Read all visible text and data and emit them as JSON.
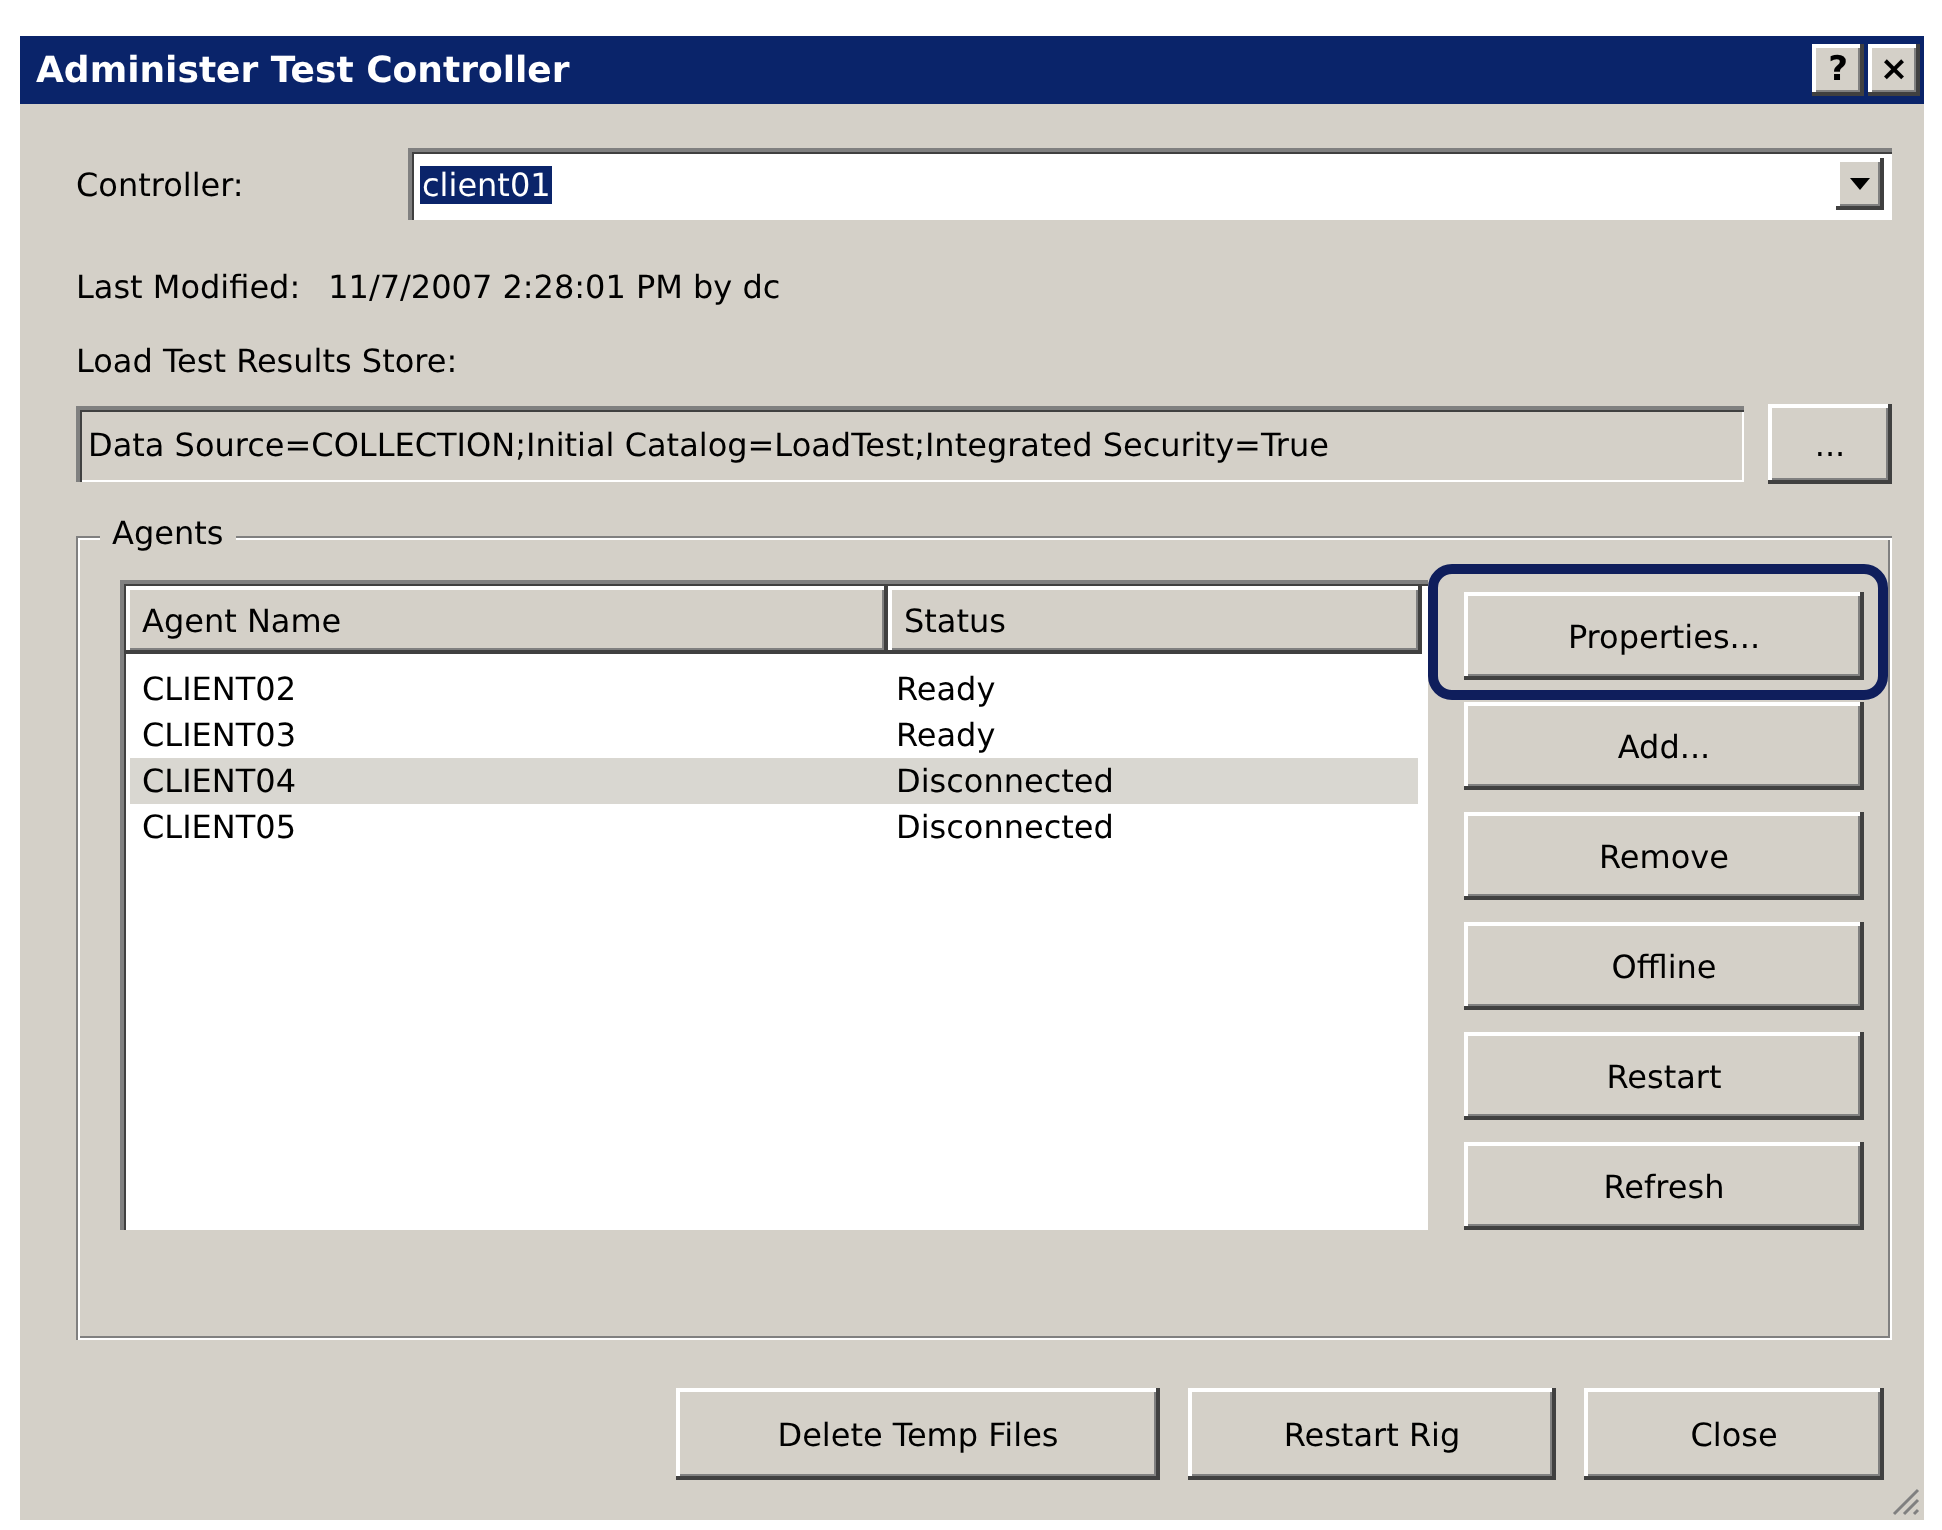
{
  "window": {
    "title": "Administer Test Controller",
    "title_buttons": [
      "?",
      "×"
    ]
  },
  "controller": {
    "label": "Controller:",
    "value": "client01",
    "value_selected": true
  },
  "last_modified": {
    "label": "Last Modified:",
    "value": "11/7/2007 2:28:01 PM by dc"
  },
  "results_store": {
    "label": "Load Test Results Store:",
    "value": "Data Source=COLLECTION;Initial Catalog=LoadTest;Integrated Security=True",
    "browse_button": "..."
  },
  "agents": {
    "title": "Agents",
    "columns": [
      "Agent Name",
      "Status"
    ],
    "rows": [
      {
        "name": "CLIENT02",
        "status": "Ready",
        "selected": false
      },
      {
        "name": "CLIENT03",
        "status": "Ready",
        "selected": false
      },
      {
        "name": "CLIENT04",
        "status": "Disconnected",
        "selected": true
      },
      {
        "name": "CLIENT05",
        "status": "Disconnected",
        "selected": false
      }
    ],
    "buttons": [
      {
        "label": "Properties...",
        "highlighted": true
      },
      {
        "label": "Add...",
        "highlighted": false
      },
      {
        "label": "Remove",
        "highlighted": false
      },
      {
        "label": "Offline",
        "highlighted": false
      },
      {
        "label": "Restart",
        "highlighted": false
      },
      {
        "label": "Refresh",
        "highlighted": false
      }
    ]
  },
  "footer_buttons": [
    "Delete Temp Files",
    "Restart Rig",
    "Close"
  ]
}
